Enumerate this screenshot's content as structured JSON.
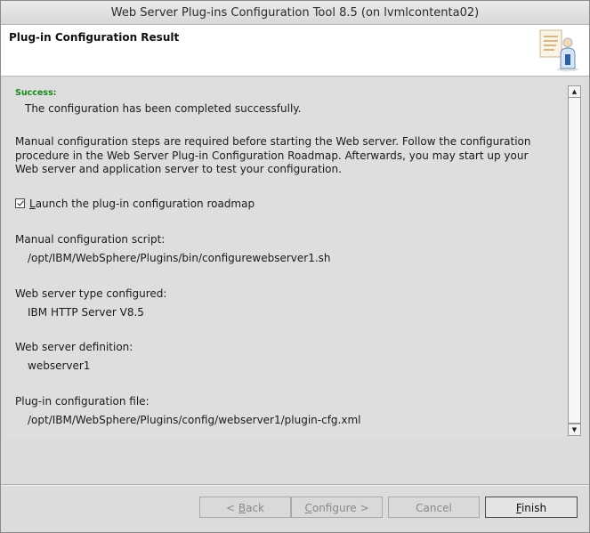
{
  "window": {
    "title": "Web Server Plug-ins Configuration Tool 8.5  (on lvmlcontenta02)"
  },
  "header": {
    "title": "Plug-in Configuration Result",
    "icon": "document-person-icon"
  },
  "content": {
    "success_label": "Success:",
    "success_message": "The configuration has been completed successfully.",
    "instructions": "Manual configuration steps are required before starting the Web server. Follow the configuration procedure in the Web Server Plug-in Configuration Roadmap. Afterwards, you may start up your Web server and application server to test your configuration.",
    "checkbox": {
      "label_mnemonic": "L",
      "label_rest": "aunch the plug-in configuration roadmap",
      "checked": true
    },
    "fields": [
      {
        "label": "Manual configuration script:",
        "value": "/opt/IBM/WebSphere/Plugins/bin/configurewebserver1.sh"
      },
      {
        "label": "Web server type configured:",
        "value": "IBM HTTP Server V8.5"
      },
      {
        "label": "Web server definition:",
        "value": "webserver1"
      },
      {
        "label": "Plug-in configuration file:",
        "value": "/opt/IBM/WebSphere/Plugins/config/webserver1/plugin-cfg.xml"
      }
    ]
  },
  "buttons": {
    "back": {
      "prefix": "< ",
      "mnemonic": "B",
      "rest": "ack",
      "enabled": false
    },
    "configure": {
      "prefix": "",
      "mnemonic": "C",
      "rest": "onfigure >",
      "enabled": false
    },
    "cancel": {
      "label": "Cancel",
      "enabled": false
    },
    "finish": {
      "mnemonic": "F",
      "rest": "inish",
      "enabled": true
    }
  },
  "colors": {
    "success": "#168a16",
    "panel_background": "#dedede",
    "header_background": "#ffffff"
  }
}
